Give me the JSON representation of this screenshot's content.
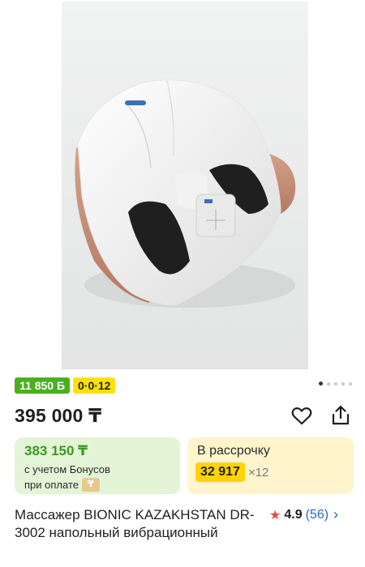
{
  "product_image": {
    "alt": "foot-massager-photo"
  },
  "gallery": {
    "total_dots": 5,
    "active_dot": 1
  },
  "badges": {
    "bonus": "11 850 Б",
    "installment": "0·0·12"
  },
  "price": {
    "main": "395 000 ₸"
  },
  "bonus_card": {
    "price": "383 150 ₸",
    "note_line1": "с учетом Бонусов",
    "note_line2": "при оплате"
  },
  "installment_card": {
    "label": "В рассрочку",
    "amount": "32 917",
    "times": "×12"
  },
  "product": {
    "title": "Массажер BIONIC KAZAKHSTAN DR-3002 напольный вибрационный",
    "rating": "4.9",
    "reviews": "(56)"
  },
  "colors": {
    "green_badge": "#4caf1f",
    "yellow_badge": "#ffe100",
    "green_card": "#e4f5d7",
    "yellow_card": "#fff4cc",
    "link": "#2a69c6",
    "star": "#e54a3c"
  }
}
